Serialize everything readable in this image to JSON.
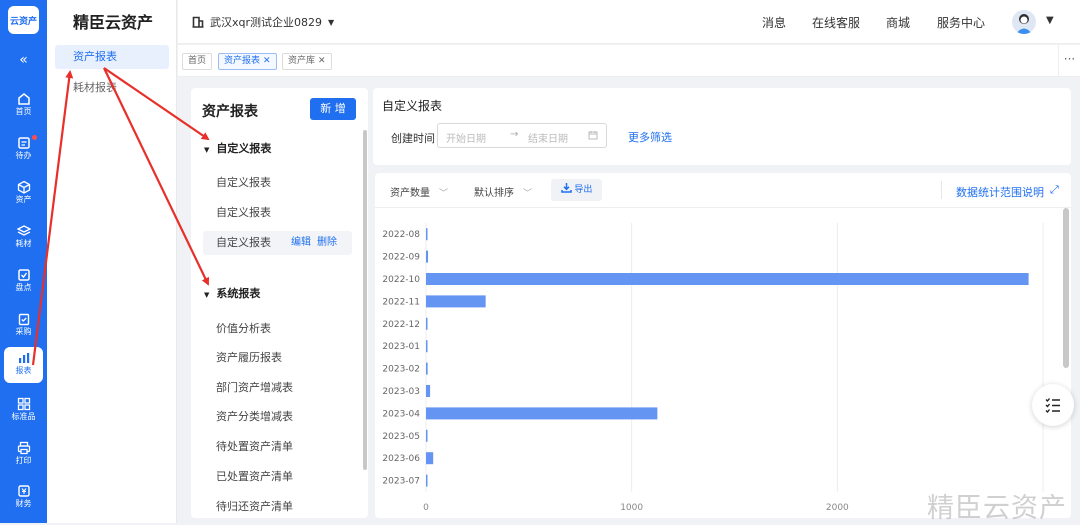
{
  "rail": {
    "logo": "云资产",
    "collapse_icon": "«",
    "items": [
      {
        "label": "首页",
        "icon": "home-icon"
      },
      {
        "label": "待办",
        "icon": "todo-icon"
      },
      {
        "label": "资产",
        "icon": "cube-icon"
      },
      {
        "label": "耗材",
        "icon": "layers-icon"
      },
      {
        "label": "盘点",
        "icon": "check-square-icon"
      },
      {
        "label": "采购",
        "icon": "clipboard-check-icon"
      },
      {
        "label": "报表",
        "icon": "bar-chart-icon"
      },
      {
        "label": "标准品",
        "icon": "grid-icon"
      },
      {
        "label": "打印",
        "icon": "printer-icon"
      },
      {
        "label": "财务",
        "icon": "finance-icon"
      }
    ]
  },
  "menu": {
    "brand": "精臣云资产",
    "items": [
      "资产报表",
      "耗材报表"
    ]
  },
  "topbar": {
    "org": "武汉xqr测试企业0829",
    "links": [
      "消息",
      "在线客服",
      "商城",
      "服务中心"
    ]
  },
  "tabs": [
    {
      "label": "首页",
      "closable": false
    },
    {
      "label": "资产报表",
      "closable": true
    },
    {
      "label": "资产库",
      "closable": true
    }
  ],
  "tabs_more": "···",
  "left_panel": {
    "title": "资产报表",
    "new_button": "新 增",
    "custom_group": "自定义报表",
    "custom_items": [
      "自定义报表",
      "自定义报表",
      "自定义报表"
    ],
    "edit": "编辑",
    "delete": "删除",
    "system_group": "系统报表",
    "system_items": [
      "价值分析表",
      "资产履历报表",
      "部门资产增减表",
      "资产分类增减表",
      "待处置资产清单",
      "已处置资产清单",
      "待归还资产清单"
    ]
  },
  "filter": {
    "title": "自定义报表",
    "created_label": "创建时间",
    "start_placeholder": "开始日期",
    "arrow": "→",
    "end_placeholder": "结束日期",
    "more_filter": "更多筛选"
  },
  "chart_toolbar": {
    "metric": "资产数量",
    "sort": "默认排序",
    "export": "导出",
    "explain": "数据统计范围说明"
  },
  "chart_data": {
    "type": "bar",
    "orientation": "horizontal",
    "categories": [
      "2022-08",
      "2022-09",
      "2022-10",
      "2022-11",
      "2022-12",
      "2023-01",
      "2023-02",
      "2023-03",
      "2023-04",
      "2023-05",
      "2023-06",
      "2023-07"
    ],
    "values": [
      4,
      10,
      2930,
      290,
      3,
      2,
      8,
      20,
      1125,
      2,
      35,
      4
    ],
    "xticks": [
      0,
      1000,
      2000
    ],
    "xlim": [
      0,
      3000
    ],
    "grid": true,
    "color": "#6595f2"
  },
  "watermark": "精臣云资产",
  "colors": {
    "primary": "#1f6ff0",
    "annotation": "#e8302a"
  }
}
